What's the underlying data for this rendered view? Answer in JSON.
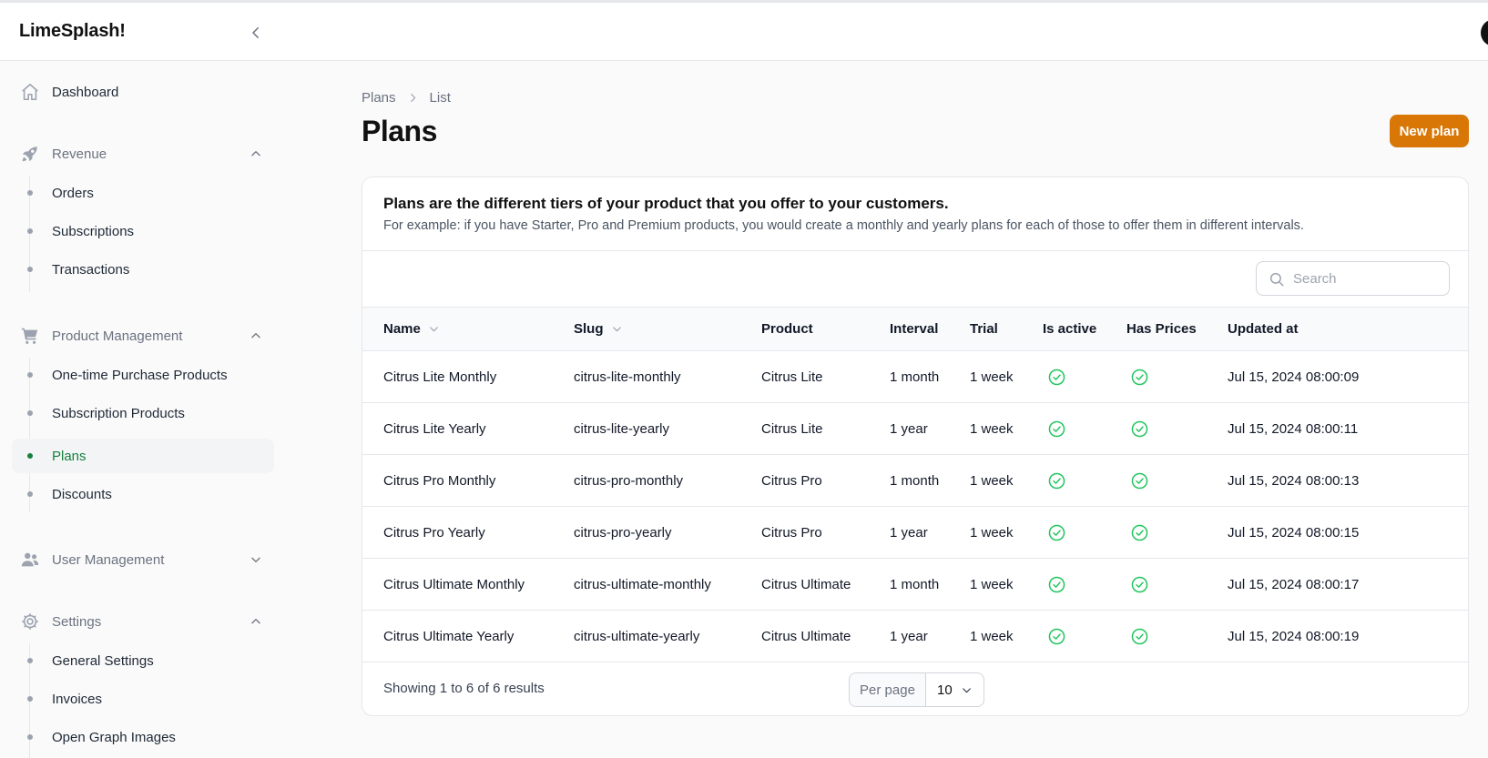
{
  "app": {
    "brand": "LimeSplash!"
  },
  "sidebar": {
    "dashboard": "Dashboard",
    "revenue": {
      "label": "Revenue",
      "items": [
        "Orders",
        "Subscriptions",
        "Transactions"
      ]
    },
    "product_management": {
      "label": "Product Management",
      "items": [
        "One-time Purchase Products",
        "Subscription Products",
        "Plans",
        "Discounts"
      ]
    },
    "user_management": {
      "label": "User Management"
    },
    "settings": {
      "label": "Settings",
      "items": [
        "General Settings",
        "Invoices",
        "Open Graph Images"
      ]
    },
    "active_item": "Plans"
  },
  "breadcrumb": {
    "parent": "Plans",
    "current": "List"
  },
  "page": {
    "title": "Plans",
    "new_button": "New plan"
  },
  "info": {
    "title": "Plans are the different tiers of your product that you offer to your customers.",
    "description": "For example: if you have Starter, Pro and Premium products, you would create a monthly and yearly plans for each of those to offer them in different intervals."
  },
  "search": {
    "placeholder": "Search",
    "value": ""
  },
  "table": {
    "columns": [
      "Name",
      "Slug",
      "Product",
      "Interval",
      "Trial",
      "Is active",
      "Has Prices",
      "Updated at"
    ],
    "rows": [
      {
        "name": "Citrus Lite Monthly",
        "slug": "citrus-lite-monthly",
        "product": "Citrus Lite",
        "interval": "1 month",
        "trial": "1 week",
        "is_active": true,
        "has_prices": true,
        "updated_at": "Jul 15, 2024 08:00:09"
      },
      {
        "name": "Citrus Lite Yearly",
        "slug": "citrus-lite-yearly",
        "product": "Citrus Lite",
        "interval": "1 year",
        "trial": "1 week",
        "is_active": true,
        "has_prices": true,
        "updated_at": "Jul 15, 2024 08:00:11"
      },
      {
        "name": "Citrus Pro Monthly",
        "slug": "citrus-pro-monthly",
        "product": "Citrus Pro",
        "interval": "1 month",
        "trial": "1 week",
        "is_active": true,
        "has_prices": true,
        "updated_at": "Jul 15, 2024 08:00:13"
      },
      {
        "name": "Citrus Pro Yearly",
        "slug": "citrus-pro-yearly",
        "product": "Citrus Pro",
        "interval": "1 year",
        "trial": "1 week",
        "is_active": true,
        "has_prices": true,
        "updated_at": "Jul 15, 2024 08:00:15"
      },
      {
        "name": "Citrus Ultimate Monthly",
        "slug": "citrus-ultimate-monthly",
        "product": "Citrus Ultimate",
        "interval": "1 month",
        "trial": "1 week",
        "is_active": true,
        "has_prices": true,
        "updated_at": "Jul 15, 2024 08:00:17"
      },
      {
        "name": "Citrus Ultimate Yearly",
        "slug": "citrus-ultimate-yearly",
        "product": "Citrus Ultimate",
        "interval": "1 year",
        "trial": "1 week",
        "is_active": true,
        "has_prices": true,
        "updated_at": "Jul 15, 2024 08:00:19"
      }
    ]
  },
  "pagination": {
    "results": "Showing 1 to 6 of 6 results",
    "per_page_label": "Per page",
    "per_page_value": "10"
  },
  "colors": {
    "accent": "#d97706",
    "active_nav": "#15803d",
    "check": "#22c55e"
  },
  "icons": [
    "chevron-left-icon",
    "home-icon",
    "rocket-icon",
    "cart-icon",
    "users-icon",
    "gear-icon",
    "chevron-up-icon",
    "chevron-down-icon",
    "search-icon",
    "check-circle-icon"
  ]
}
